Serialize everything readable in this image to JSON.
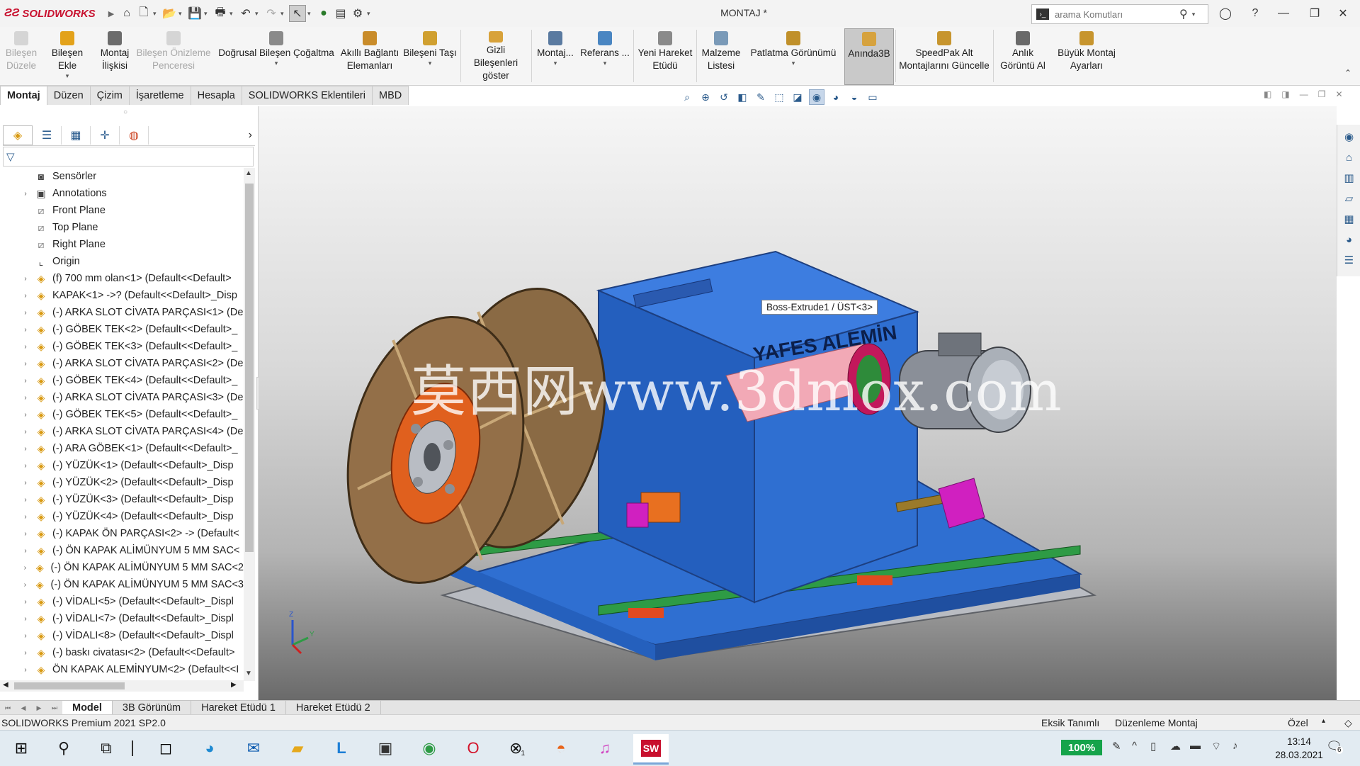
{
  "app": {
    "name": "SOLIDWORKS",
    "document_title": "MONTAJ *"
  },
  "colors": {
    "accent": "#c8102e",
    "ribbon_bg": "#f5f5f5",
    "viewport_top": "#f6f6f6",
    "viewport_bottom": "#6a6a6a",
    "model_blue": "#2f6fd1",
    "battery": "#15a34a"
  },
  "search": {
    "placeholder": "arama Komutları"
  },
  "ribbon": {
    "buttons": [
      {
        "id": "bilesen-duzenle",
        "label": "Bileşen\nDüzele",
        "icon": "edit-component-icon",
        "disabled": true
      },
      {
        "id": "bilesen-ekle",
        "label": "Bileşen Ekle",
        "icon": "insert-component-icon",
        "disabled": false
      },
      {
        "id": "montaj-iliskisi",
        "label": "Montaj\nİlişkisi",
        "icon": "mate-icon",
        "disabled": false
      },
      {
        "id": "bilesen-onizleme",
        "label": "Bileşen Önizleme\nPenceresi",
        "icon": "preview-window-icon",
        "disabled": true
      },
      {
        "id": "dogrusal",
        "label": "Doğrusal Bileşen Çoğaltma",
        "icon": "linear-pattern-icon",
        "disabled": false
      },
      {
        "id": "akilli",
        "label": "Akıllı Bağlantı\nElemanları",
        "icon": "smart-fasteners-icon",
        "disabled": false
      },
      {
        "id": "bileseni-tasi",
        "label": "Bileşeni Taşı",
        "icon": "move-component-icon",
        "disabled": false
      },
      {
        "id": "gizli",
        "label": "Gizli Bileşenleri\ngöster",
        "icon": "show-hidden-icon",
        "disabled": false
      },
      {
        "id": "montaj",
        "label": "Montaj...",
        "icon": "assembly-features-icon",
        "disabled": false
      },
      {
        "id": "referans",
        "label": "Referans ...",
        "icon": "reference-geometry-icon",
        "disabled": false
      },
      {
        "id": "yeni-hareket",
        "label": "Yeni Hareket\nEtüdü",
        "icon": "motion-study-icon",
        "disabled": false
      },
      {
        "id": "malzeme",
        "label": "Malzeme\nListesi",
        "icon": "bom-icon",
        "disabled": false
      },
      {
        "id": "patlatma",
        "label": "Patlatma Görünümü",
        "icon": "exploded-view-icon",
        "disabled": false
      },
      {
        "id": "aninda",
        "label": "Anında3B",
        "icon": "instant3d-icon",
        "disabled": false
      },
      {
        "id": "speedpak",
        "label": "SpeedPak Alt\nMontajlarını Güncelle",
        "icon": "speedpak-icon",
        "disabled": false
      },
      {
        "id": "anlik",
        "label": "Anlık\nGörüntü Al",
        "icon": "snapshot-icon",
        "disabled": false
      },
      {
        "id": "buyuk",
        "label": "Büyük Montaj\nAyarları",
        "icon": "large-assembly-icon",
        "disabled": false
      }
    ]
  },
  "command_tabs": [
    "Montaj",
    "Düzen",
    "Çizim",
    "İşaretleme",
    "Hesapla",
    "SOLIDWORKS Eklentileri",
    "MBD"
  ],
  "tree": {
    "items": [
      {
        "label": "Sensörler",
        "type": "misc",
        "icon": "sensor-icon",
        "expandable": false
      },
      {
        "label": "Annotations",
        "type": "misc",
        "icon": "annotation-icon",
        "expandable": true
      },
      {
        "label": "Front Plane",
        "type": "plane",
        "icon": "plane-icon",
        "expandable": false
      },
      {
        "label": "Top Plane",
        "type": "plane",
        "icon": "plane-icon",
        "expandable": false
      },
      {
        "label": "Right Plane",
        "type": "plane",
        "icon": "plane-icon",
        "expandable": false
      },
      {
        "label": "Origin",
        "type": "misc",
        "icon": "origin-icon",
        "expandable": false
      },
      {
        "label": "(f) 700 mm olan<1> (Default<<Default>",
        "type": "part",
        "icon": "part-icon",
        "expandable": true
      },
      {
        "label": "KAPAK<1> ->? (Default<<Default>_Disp",
        "type": "part",
        "icon": "part-icon",
        "expandable": true
      },
      {
        "label": "(-) ARKA SLOT CİVATA PARÇASI<1> (De",
        "type": "part",
        "icon": "part-icon",
        "expandable": true
      },
      {
        "label": "(-) GÖBEK TEK<2> (Default<<Default>_",
        "type": "part",
        "icon": "part-icon",
        "expandable": true
      },
      {
        "label": "(-) GÖBEK TEK<3> (Default<<Default>_",
        "type": "part",
        "icon": "part-icon",
        "expandable": true
      },
      {
        "label": "(-) ARKA SLOT CİVATA PARÇASI<2> (De",
        "type": "part",
        "icon": "part-icon",
        "expandable": true
      },
      {
        "label": "(-) GÖBEK TEK<4> (Default<<Default>_",
        "type": "part",
        "icon": "part-icon",
        "expandable": true
      },
      {
        "label": "(-) ARKA SLOT CİVATA PARÇASI<3> (De",
        "type": "part",
        "icon": "part-icon",
        "expandable": true
      },
      {
        "label": "(-) GÖBEK TEK<5> (Default<<Default>_",
        "type": "part",
        "icon": "part-icon",
        "expandable": true
      },
      {
        "label": "(-) ARKA SLOT CİVATA PARÇASI<4> (De",
        "type": "part",
        "icon": "part-icon",
        "expandable": true
      },
      {
        "label": "(-) ARA GÖBEK<1> (Default<<Default>_",
        "type": "part",
        "icon": "part-icon",
        "expandable": true
      },
      {
        "label": "(-) YÜZÜK<1> (Default<<Default>_Disp",
        "type": "part",
        "icon": "part-icon",
        "expandable": true
      },
      {
        "label": "(-) YÜZÜK<2> (Default<<Default>_Disp",
        "type": "part",
        "icon": "part-icon",
        "expandable": true
      },
      {
        "label": "(-) YÜZÜK<3> (Default<<Default>_Disp",
        "type": "part",
        "icon": "part-icon",
        "expandable": true
      },
      {
        "label": "(-) YÜZÜK<4> (Default<<Default>_Disp",
        "type": "part",
        "icon": "part-icon",
        "expandable": true
      },
      {
        "label": "(-) KAPAK ÖN PARÇASI<2> -> (Default<",
        "type": "part",
        "icon": "part-icon",
        "expandable": true
      },
      {
        "label": "(-) ÖN KAPAK ALİMÜNYUM 5 MM SAC<",
        "type": "part",
        "icon": "part-icon",
        "expandable": true
      },
      {
        "label": "(-) ÖN KAPAK ALİMÜNYUM 5 MM SAC<2",
        "type": "part",
        "icon": "part-icon",
        "expandable": true
      },
      {
        "label": "(-) ÖN KAPAK ALİMÜNYUM 5 MM SAC<3",
        "type": "part",
        "icon": "part-icon",
        "expandable": true
      },
      {
        "label": "(-) VİDALI<5> (Default<<Default>_Displ",
        "type": "part",
        "icon": "part-icon",
        "expandable": true
      },
      {
        "label": "(-) VİDALI<7> (Default<<Default>_Displ",
        "type": "part",
        "icon": "part-icon",
        "expandable": true
      },
      {
        "label": "(-) VİDALI<8> (Default<<Default>_Displ",
        "type": "part",
        "icon": "part-icon",
        "expandable": true
      },
      {
        "label": "(-) baskı civatası<2> (Default<<Default>",
        "type": "part",
        "icon": "part-icon",
        "expandable": true
      },
      {
        "label": "ÖN KAPAK ALEMİNYUM<2> (Default<<I",
        "type": "part",
        "icon": "part-icon",
        "expandable": true
      }
    ]
  },
  "viewport": {
    "tooltip": "Boss-Extrude1 / ÜST<3>",
    "model_label": "YAFES ALEMİN",
    "watermark": "莫西网www.3dmox.com",
    "triad_axis_labels": [
      "Z",
      "Y"
    ]
  },
  "bottom_tabs": [
    "Model",
    "3B Görünüm",
    "Hareket Etüdü 1",
    "Hareket Etüdü 2"
  ],
  "status": {
    "version": "SOLIDWORKS Premium 2021 SP2.0",
    "definition": "Eksik Tanımlı",
    "mode": "Düzenleme Montaj",
    "units": "Özel"
  },
  "taskbar": {
    "battery": "100%",
    "time": "13:14",
    "date": "28.03.2021",
    "xbox_badge": "1",
    "notification_badge": "6",
    "apps": [
      "start-icon",
      "search-icon",
      "task-view-icon",
      "dropbox-icon",
      "edge-icon",
      "outlook-icon",
      "explorer-icon",
      "l-app-icon",
      "store-icon",
      "chrome-icon",
      "opera-icon",
      "xbox-icon",
      "firefox-icon",
      "itunes-icon",
      "solidworks-icon"
    ]
  }
}
